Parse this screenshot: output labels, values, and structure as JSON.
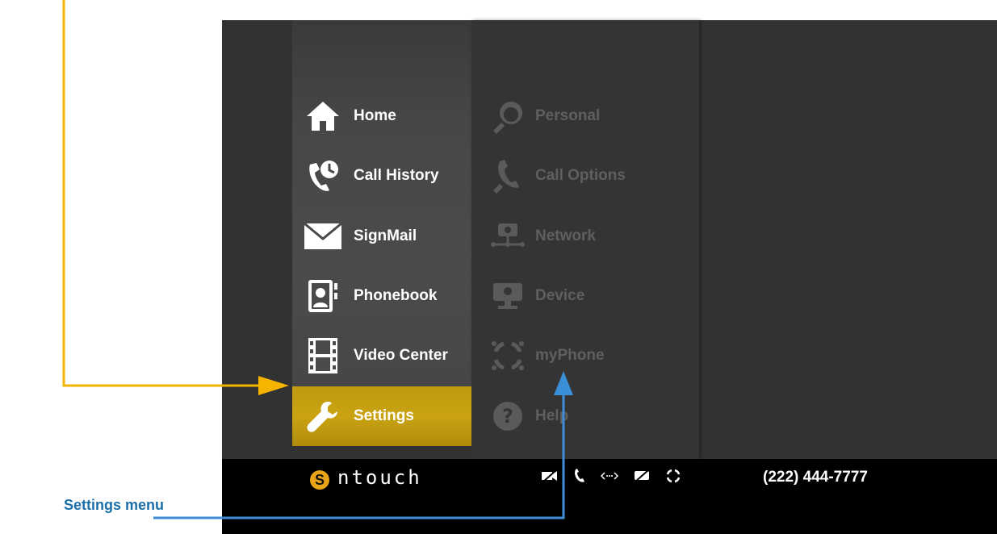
{
  "main_menu": {
    "items": [
      {
        "label": "Home",
        "icon": "home-icon"
      },
      {
        "label": "Call History",
        "icon": "call-history-icon"
      },
      {
        "label": "SignMail",
        "icon": "envelope-icon"
      },
      {
        "label": "Phonebook",
        "icon": "phonebook-icon"
      },
      {
        "label": "Video Center",
        "icon": "film-icon"
      },
      {
        "label": "Settings",
        "icon": "wrench-icon",
        "selected": true
      }
    ]
  },
  "settings_menu": {
    "items": [
      {
        "label": "Personal",
        "icon": "personal-icon"
      },
      {
        "label": "Call Options",
        "icon": "call-options-icon"
      },
      {
        "label": "Network",
        "icon": "network-icon"
      },
      {
        "label": "Device",
        "icon": "device-icon"
      },
      {
        "label": "myPhone",
        "icon": "myphone-icon"
      },
      {
        "label": "Help",
        "icon": "help-icon"
      }
    ]
  },
  "status_bar": {
    "logo_text": "ntouch",
    "logo_mark": "S",
    "phone_number": "(222) 444-7777",
    "icons": [
      "video-off-icon",
      "phone-icon",
      "network-status-icon",
      "camera-off-icon",
      "myphone-status-icon"
    ]
  },
  "annotations": {
    "callout_label": "Settings menu"
  },
  "colors": {
    "accent_gold": "#c9a311",
    "callout_yellow": "#f5b400",
    "callout_blue": "#3b8fd6"
  }
}
